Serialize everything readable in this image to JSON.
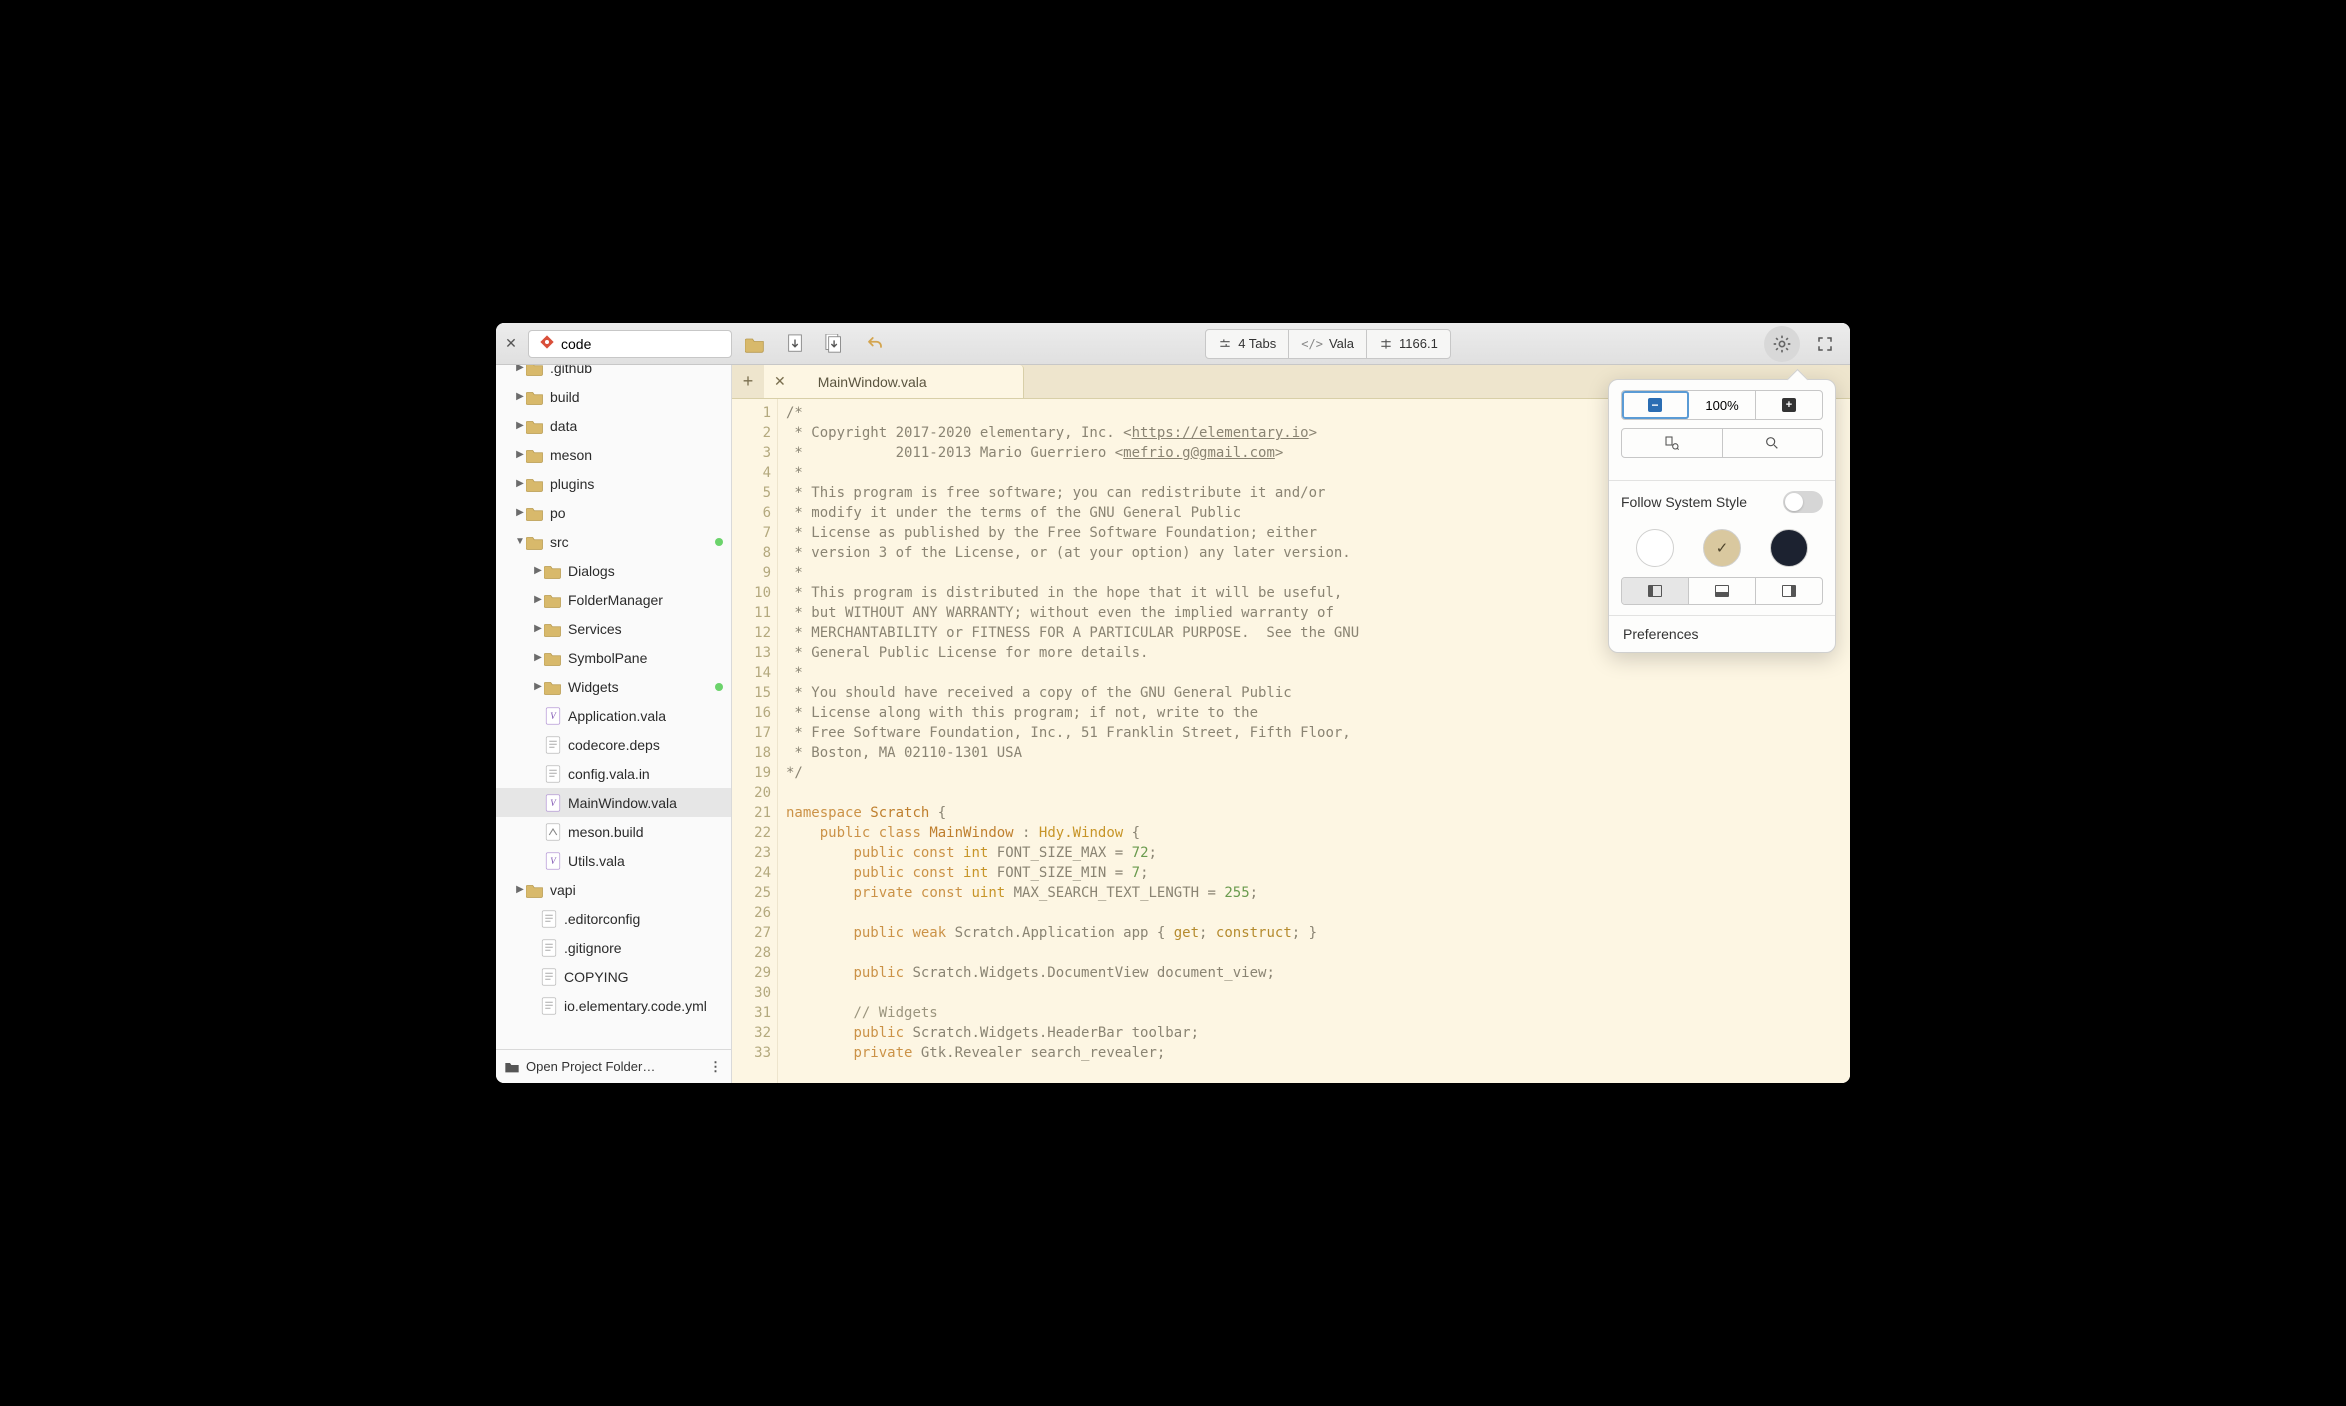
{
  "project": {
    "name": "code"
  },
  "toolbar": {
    "tabs_label": "4 Tabs",
    "lang_label": "Vala",
    "line_col": "1166.1"
  },
  "popover": {
    "zoom": "100%",
    "follow_label": "Follow System Style",
    "prefs_label": "Preferences"
  },
  "tabs": {
    "active": "MainWindow.vala"
  },
  "sidebar": {
    "open_folder": "Open Project Folder…",
    "tree": [
      {
        "d": 0,
        "icon": "folder",
        "label": ".github",
        "arrow": "r",
        "cut": true
      },
      {
        "d": 0,
        "icon": "folder",
        "label": "build",
        "arrow": "r"
      },
      {
        "d": 0,
        "icon": "folder",
        "label": "data",
        "arrow": "r"
      },
      {
        "d": 0,
        "icon": "folder",
        "label": "meson",
        "arrow": "r"
      },
      {
        "d": 0,
        "icon": "folder",
        "label": "plugins",
        "arrow": "r"
      },
      {
        "d": 0,
        "icon": "folder",
        "label": "po",
        "arrow": "r"
      },
      {
        "d": 0,
        "icon": "folder",
        "label": "src",
        "arrow": "d",
        "dot": true
      },
      {
        "d": 1,
        "icon": "folder",
        "label": "Dialogs",
        "arrow": "r"
      },
      {
        "d": 1,
        "icon": "folder",
        "label": "FolderManager",
        "arrow": "r"
      },
      {
        "d": 1,
        "icon": "folder",
        "label": "Services",
        "arrow": "r"
      },
      {
        "d": 1,
        "icon": "folder",
        "label": "SymbolPane",
        "arrow": "r"
      },
      {
        "d": 1,
        "icon": "folder",
        "label": "Widgets",
        "arrow": "r",
        "dot": true
      },
      {
        "d": 1,
        "icon": "vala",
        "label": "Application.vala"
      },
      {
        "d": 1,
        "icon": "text",
        "label": "codecore.deps"
      },
      {
        "d": 1,
        "icon": "text",
        "label": "config.vala.in"
      },
      {
        "d": 1,
        "icon": "vala",
        "label": "MainWindow.vala",
        "selected": true
      },
      {
        "d": 1,
        "icon": "meson",
        "label": "meson.build"
      },
      {
        "d": 1,
        "icon": "vala",
        "label": "Utils.vala"
      },
      {
        "d": 0,
        "icon": "folder",
        "label": "vapi",
        "arrow": "r"
      },
      {
        "d": 0,
        "icon": "text",
        "label": ".editorconfig",
        "nd": 1
      },
      {
        "d": 0,
        "icon": "text",
        "label": ".gitignore",
        "nd": 1
      },
      {
        "d": 0,
        "icon": "text",
        "label": "COPYING",
        "nd": 1
      },
      {
        "d": 0,
        "icon": "text",
        "label": "io.elementary.code.yml",
        "nd": 1
      }
    ]
  },
  "code": {
    "lines": [
      {
        "n": 1,
        "html": "<span class='comment'>/*</span>"
      },
      {
        "n": 2,
        "html": "<span class='comment'> * Copyright 2017-2020 elementary, Inc. &lt;<span class='lnk'>https://elementary.io</span>&gt;</span>"
      },
      {
        "n": 3,
        "html": "<span class='comment'> *           2011-2013 Mario Guerriero &lt;<span class='lnk'>mefrio.g@gmail.com</span>&gt;</span>"
      },
      {
        "n": 4,
        "html": "<span class='comment'> *</span>"
      },
      {
        "n": 5,
        "html": "<span class='comment'> * This program is free software; you can redistribute it and/or</span>"
      },
      {
        "n": 6,
        "html": "<span class='comment'> * modify it under the terms of the GNU General Public</span>"
      },
      {
        "n": 7,
        "html": "<span class='comment'> * License as published by the Free Software Foundation; either</span>"
      },
      {
        "n": 8,
        "html": "<span class='comment'> * version 3 of the License, or (at your option) any later version.</span>"
      },
      {
        "n": 9,
        "html": "<span class='comment'> *</span>"
      },
      {
        "n": 10,
        "html": "<span class='comment'> * This program is distributed in the hope that it will be useful,</span>"
      },
      {
        "n": 11,
        "html": "<span class='comment'> * but WITHOUT ANY WARRANTY; without even the implied warranty of</span>"
      },
      {
        "n": 12,
        "html": "<span class='comment'> * MERCHANTABILITY or FITNESS FOR A PARTICULAR PURPOSE.  See the GNU</span>"
      },
      {
        "n": 13,
        "html": "<span class='comment'> * General Public License for more details.</span>"
      },
      {
        "n": 14,
        "html": "<span class='comment'> *</span>"
      },
      {
        "n": 15,
        "html": "<span class='comment'> * You should have received a copy of the GNU General Public</span>"
      },
      {
        "n": 16,
        "html": "<span class='comment'> * License along with this program; if not, write to the</span>"
      },
      {
        "n": 17,
        "html": "<span class='comment'> * Free Software Foundation, Inc., 51 Franklin Street, Fifth Floor,</span>"
      },
      {
        "n": 18,
        "html": "<span class='comment'> * Boston, MA 02110-1301 USA</span>"
      },
      {
        "n": 19,
        "html": "<span class='comment'>*/</span>"
      },
      {
        "n": 20,
        "html": ""
      },
      {
        "n": 21,
        "html": "<span class='kw'>namespace</span> <span class='cls'>Scratch</span> {"
      },
      {
        "n": 22,
        "html": "    <span class='kw'>public</span> <span class='kw'>class</span> <span class='cls'>MainWindow</span> : <span class='type'>Hdy.Window</span> {"
      },
      {
        "n": 23,
        "html": "        <span class='kw'>public</span> <span class='kw'>const</span> <span class='type'>int</span> FONT_SIZE_MAX = <span class='num'>72</span>;"
      },
      {
        "n": 24,
        "html": "        <span class='kw'>public</span> <span class='kw'>const</span> <span class='type'>int</span> FONT_SIZE_MIN = <span class='num'>7</span>;"
      },
      {
        "n": 25,
        "html": "        <span class='kw'>private</span> <span class='kw'>const</span> <span class='type'>uint</span> MAX_SEARCH_TEXT_LENGTH = <span class='num'>255</span>;"
      },
      {
        "n": 26,
        "html": ""
      },
      {
        "n": 27,
        "html": "        <span class='kw'>public</span> <span class='kw'>weak</span> Scratch.Application app { <span class='mod'>get</span>; <span class='mod'>construct</span>; }"
      },
      {
        "n": 28,
        "html": ""
      },
      {
        "n": 29,
        "html": "        <span class='kw'>public</span> Scratch.Widgets.DocumentView document_view;"
      },
      {
        "n": 30,
        "html": ""
      },
      {
        "n": 31,
        "html": "        <span class='cm2'>// Widgets</span>"
      },
      {
        "n": 32,
        "html": "        <span class='kw'>public</span> Scratch.Widgets.HeaderBar toolbar;"
      },
      {
        "n": 33,
        "html": "        <span class='kw'>private</span> Gtk.Revealer search_revealer;"
      }
    ]
  }
}
